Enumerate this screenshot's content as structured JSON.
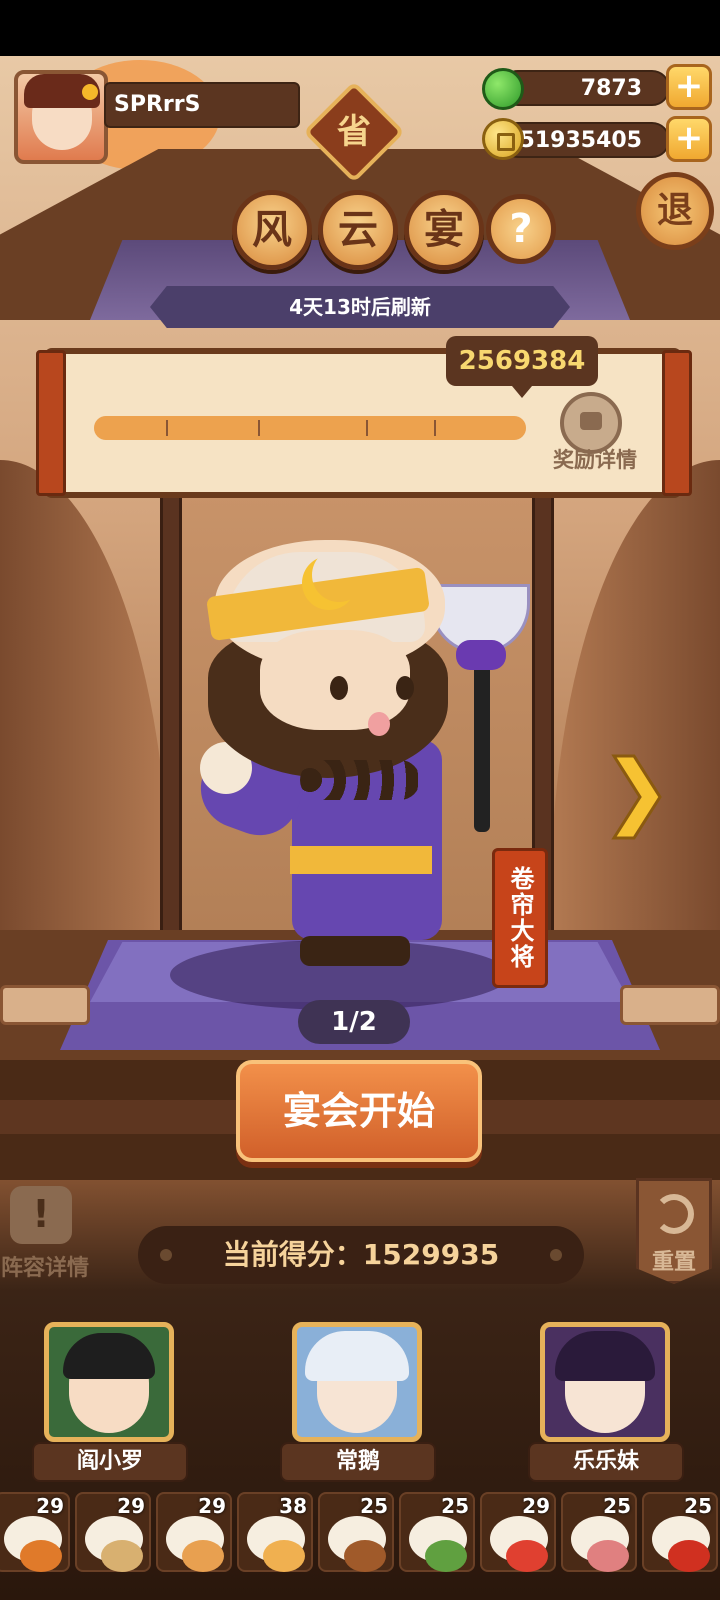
{
  "player": {
    "name": "SPRrrS"
  },
  "badge": {
    "province": "省"
  },
  "resources": {
    "gems": "7873",
    "coins": "51935405",
    "plus": "+"
  },
  "exit": {
    "label": "退"
  },
  "title": {
    "chars": [
      "风",
      "云",
      "宴"
    ],
    "help": "?"
  },
  "refresh": {
    "text": "4天13时后刷新"
  },
  "progress": {
    "target_score": "2569384",
    "reward_label": "奖励详情",
    "fill_fraction": 1.0
  },
  "character": {
    "banner": "卷帘大将",
    "page": "1/2"
  },
  "start_button": {
    "label": "宴会开始"
  },
  "lineup_details": {
    "label": "阵容详情"
  },
  "reset": {
    "label": "重置"
  },
  "current_score": {
    "label": "当前得分：1529935"
  },
  "lineup": [
    {
      "name": "阎小罗",
      "color": "#3a6a3a"
    },
    {
      "name": "常鹅",
      "color": "#8ab0d8"
    },
    {
      "name": "乐乐妹",
      "color": "#4a3060"
    }
  ],
  "dishes": [
    {
      "count": "29",
      "color": "#e07a2a"
    },
    {
      "count": "29",
      "color": "#d8b070"
    },
    {
      "count": "29",
      "color": "#e8a050"
    },
    {
      "count": "38",
      "color": "#f0b050"
    },
    {
      "count": "25",
      "color": "#a05a2a"
    },
    {
      "count": "25",
      "color": "#60a040"
    },
    {
      "count": "29",
      "color": "#e04030"
    },
    {
      "count": "25",
      "color": "#e08080"
    },
    {
      "count": "25",
      "color": "#d03020"
    }
  ],
  "colors": {
    "accent": "#e6b25a",
    "start_button": "#e07a3a",
    "purple": "#6647b0"
  }
}
